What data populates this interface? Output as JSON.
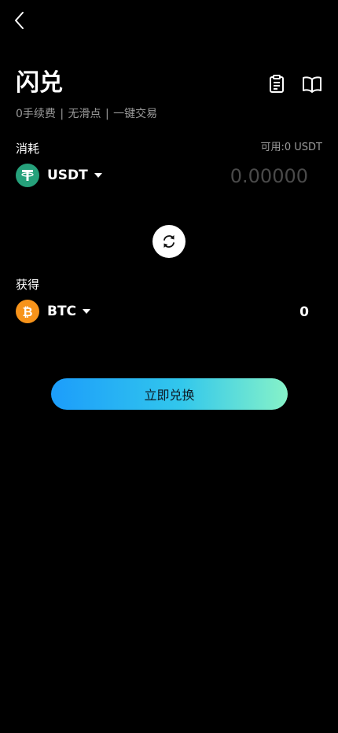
{
  "header": {
    "back_icon": "chevron-left-icon",
    "title": "闪兑",
    "records_icon": "clipboard-list-icon",
    "guide_icon": "open-book-icon"
  },
  "subtitle": {
    "features": [
      "0手续费",
      "无滑点",
      "一键交易"
    ],
    "separator": "|"
  },
  "pay": {
    "label": "消耗",
    "available": "可用:0 USDT",
    "coin": "USDT",
    "coin_icon": "tether-icon",
    "coin_color": "#26a17b",
    "amount_placeholder": "0.00000",
    "amount_value": ""
  },
  "swap": {
    "icon": "swap-arrows-icon"
  },
  "receive": {
    "label": "获得",
    "coin": "BTC",
    "coin_icon": "bitcoin-icon",
    "coin_color": "#f7931a",
    "amount": "0"
  },
  "action": {
    "exchange_label": "立即兑换",
    "gradient": [
      "#1c9dfb",
      "#86f2c8"
    ]
  }
}
